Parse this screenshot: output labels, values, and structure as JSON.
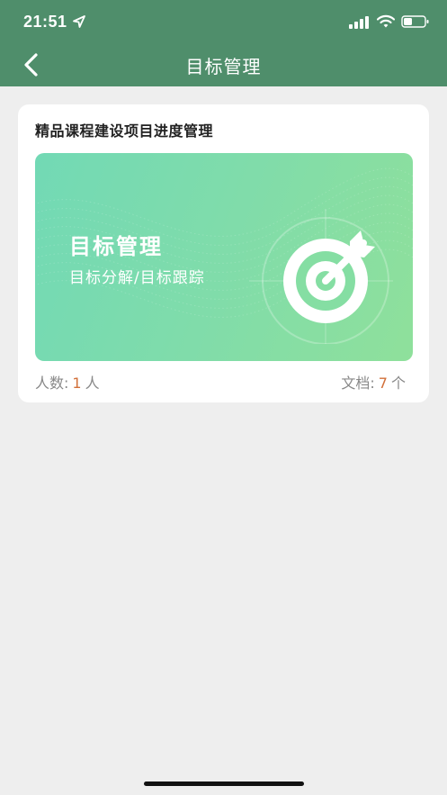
{
  "status_bar": {
    "time": "21:51",
    "icons": [
      "location-arrow-icon",
      "cellular-signal-icon",
      "wifi-icon",
      "battery-icon"
    ]
  },
  "nav": {
    "title": "目标管理",
    "back_icon": "chevron-left-icon"
  },
  "card": {
    "project_title": "精品课程建设项目进度管理",
    "banner": {
      "heading": "目标管理",
      "subheading": "目标分解/目标跟踪",
      "icon": "target-arrow-icon"
    },
    "stats": {
      "people_label": "人数:",
      "people_count": "1",
      "people_unit": "人",
      "docs_label": "文档:",
      "docs_count": "7",
      "docs_unit": "个"
    }
  },
  "colors": {
    "header_bg": "#4f8e6b",
    "page_bg": "#eeeeee",
    "accent_number": "#d2703a",
    "banner_start": "#72d9b5",
    "banner_end": "#8fe09b"
  }
}
